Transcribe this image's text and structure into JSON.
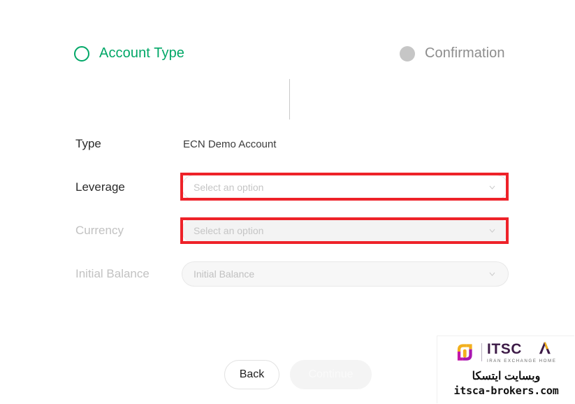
{
  "stepper": {
    "steps": [
      {
        "label": "Account Type",
        "state": "active",
        "icon": "circle-outline-icon"
      },
      {
        "label": "Confirmation",
        "state": "inactive",
        "icon": "circle-filled-icon"
      }
    ],
    "active_color": "#00a767",
    "inactive_color": "#8d8d8d"
  },
  "form": {
    "type": {
      "label": "Type",
      "value": "ECN Demo Account"
    },
    "leverage": {
      "label": "Leverage",
      "placeholder": "Select an option",
      "value": "",
      "state": "enabled",
      "highlighted": true
    },
    "currency": {
      "label": "Currency",
      "placeholder": "Select an option",
      "value": "",
      "state": "disabled",
      "highlighted": true
    },
    "initial_balance": {
      "label": "Initial Balance",
      "placeholder": "Initial Balance",
      "value": "",
      "state": "disabled",
      "highlighted": false
    }
  },
  "actions": {
    "back_label": "Back",
    "continue_label": "Continue",
    "continue_state": "disabled"
  },
  "annotation": {
    "color": "#ee2229",
    "targets": [
      "leverage-select",
      "currency-select"
    ]
  },
  "watermark": {
    "brand": "ITSCA",
    "tagline": "IRAN EXCHANGE HOME",
    "persian_text": "وبسایت ایتسکا",
    "url": "itsca-brokers.com",
    "logo_top_color": "#f2b01e",
    "logo_bottom_color": "#b5179e",
    "brand_color": "#3d1b47"
  }
}
